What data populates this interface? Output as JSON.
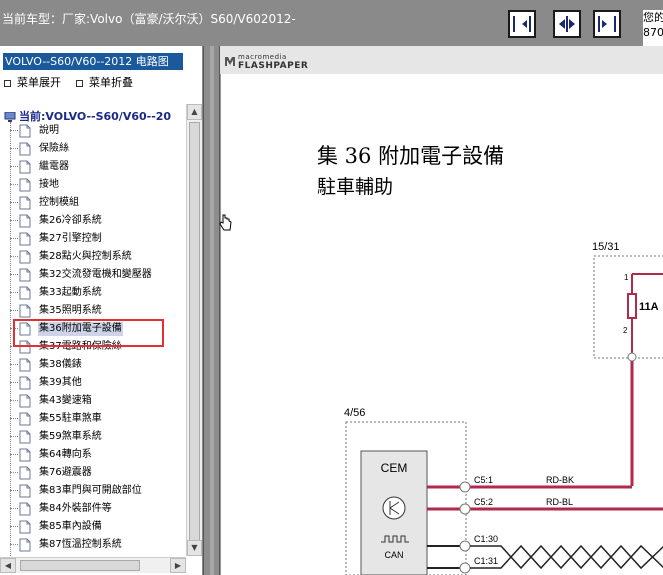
{
  "header": {
    "title": "当前车型：厂家:Volvo（富豪/沃尔沃）S60/V602012-",
    "right_text": [
      "您的",
      "870"
    ]
  },
  "toolbar": {
    "buttons": [
      "page-prev",
      "page-split",
      "page-next"
    ]
  },
  "sidebar": {
    "header": "VOLVO--S60/V60--2012 电路图",
    "expand_label": "菜单展开",
    "collapse_label": "菜单折叠",
    "root_label": "当前:VOLVO--S60/V60--20",
    "items": [
      {
        "label": "說明"
      },
      {
        "label": "保險絲"
      },
      {
        "label": "繼電器"
      },
      {
        "label": "接地"
      },
      {
        "label": "控制模組"
      },
      {
        "label": "集26冷卻系統"
      },
      {
        "label": "集27引擎控制"
      },
      {
        "label": "集28點火與控制系統"
      },
      {
        "label": "集32交流發電機和變壓器"
      },
      {
        "label": "集33起動系統"
      },
      {
        "label": "集35照明系統"
      },
      {
        "label": "集36附加電子設備",
        "selected": true
      },
      {
        "label": "集37電路和保險絲"
      },
      {
        "label": "集38儀錶"
      },
      {
        "label": "集39其他"
      },
      {
        "label": "集43變速箱"
      },
      {
        "label": "集55駐車煞車"
      },
      {
        "label": "集59煞車系統"
      },
      {
        "label": "集64轉向系"
      },
      {
        "label": "集76避震器"
      },
      {
        "label": "集83車門與可開啟部位"
      },
      {
        "label": "集84外裝部件等"
      },
      {
        "label": "集85車內設備"
      },
      {
        "label": "集87恆溫控制系統"
      }
    ]
  },
  "viewer": {
    "brand_small": "macromedia",
    "brand_big": "FLASHPAPER",
    "page_title_line1": "集 36 附加電子設備",
    "page_title_line2": "駐車輔助",
    "schematic": {
      "label_15_31": "15/31",
      "label_4_56": "4/56",
      "pin_1": "1",
      "pin_2": "2",
      "fuse_label": "11A",
      "module_name": "CEM",
      "can_label": "CAN",
      "connectors": [
        "C5:1",
        "C5:2",
        "C1:30",
        "C1:31"
      ],
      "wires": [
        "RD-BK",
        "RD-BL"
      ]
    }
  },
  "colors": {
    "top_bar": "#8a8a8a",
    "sidebar_header": "#1a5a9c",
    "highlight_box": "#e03030",
    "wire": "#b02a4a"
  }
}
